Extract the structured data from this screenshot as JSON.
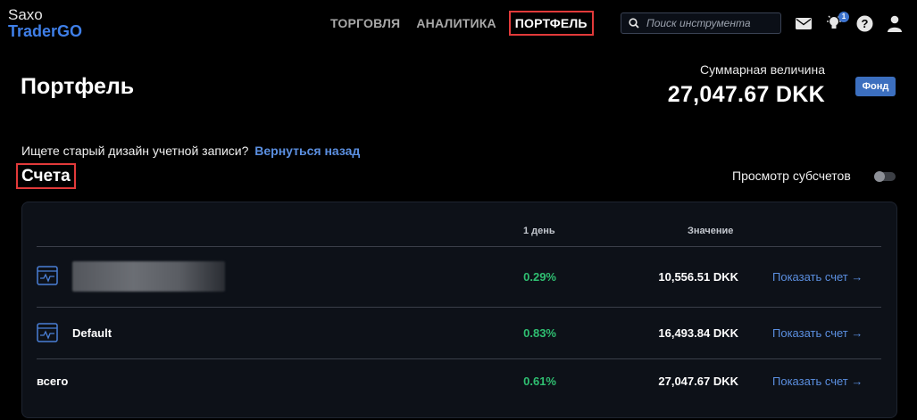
{
  "brand": {
    "line1": "Saxo",
    "line2": "TraderGO"
  },
  "nav": [
    {
      "label": "ТОРГОВЛЯ"
    },
    {
      "label": "АНАЛИТИКА"
    },
    {
      "label": "ПОРТФЕЛЬ",
      "active": true
    }
  ],
  "search": {
    "placeholder": "Поиск инструмента"
  },
  "notifications": {
    "count": "1"
  },
  "page": {
    "title": "Портфель"
  },
  "total": {
    "label": "Суммарная величина",
    "value": "27,047.67 DKK",
    "fund_button": "Фонд"
  },
  "legacy": {
    "text": "Ищете старый дизайн учетной записи?",
    "link": "Вернуться назад"
  },
  "accounts_section": {
    "title": "Счета",
    "subaccounts_label": "Просмотр субсчетов",
    "subaccounts_on": false
  },
  "table": {
    "headers": {
      "day": "1 день",
      "value": "Значение"
    },
    "rows": [
      {
        "name": "",
        "day": "0.29%",
        "value": "10,556.51 DKK",
        "action": "Показать счет →"
      },
      {
        "name": "Default",
        "day": "0.83%",
        "value": "16,493.84 DKK",
        "action": "Показать счет →"
      },
      {
        "name": "всего",
        "day": "0.61%",
        "value": "27,047.67 DKK",
        "action": "Показать счет →"
      }
    ]
  },
  "colors": {
    "accent": "#3f7fe8",
    "positive": "#2fbf71",
    "link": "#5b8fe0",
    "highlight": "#e23a3a"
  },
  "icons": [
    "search-icon",
    "mail-icon",
    "lightbulb-icon",
    "help-icon",
    "user-icon",
    "account-chart-icon",
    "arrow-right-icon"
  ]
}
